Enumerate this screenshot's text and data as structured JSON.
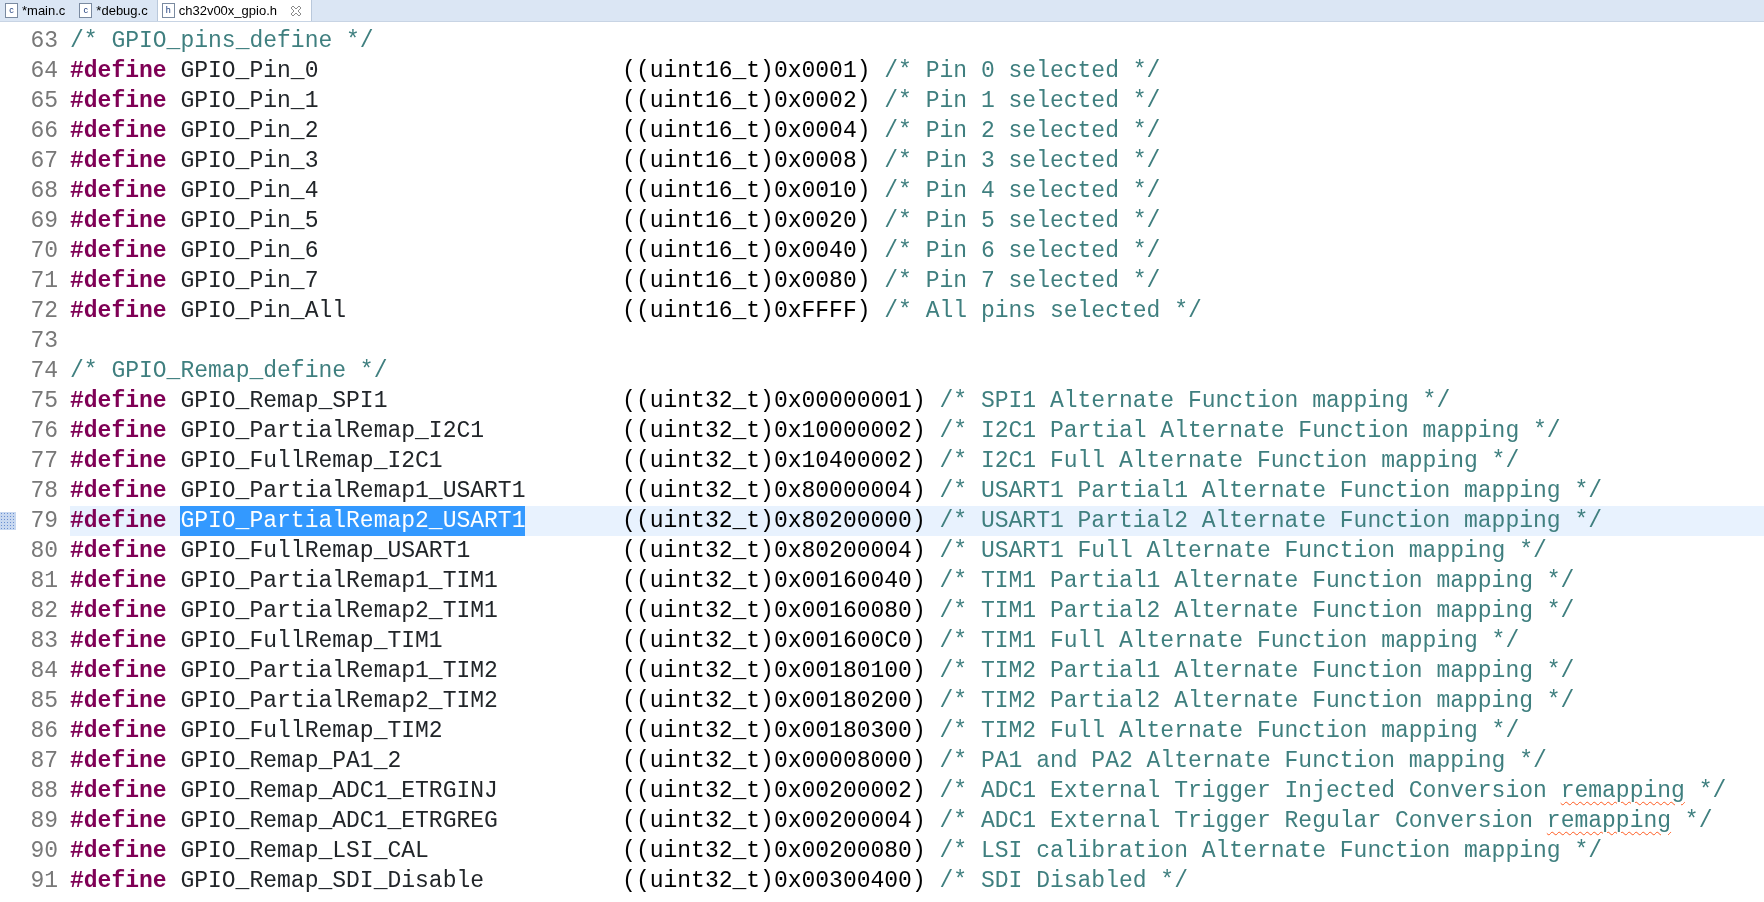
{
  "tabs": [
    {
      "icon": "c",
      "label": "*main.c",
      "selected": false,
      "closable": false
    },
    {
      "icon": "c",
      "label": "*debug.c",
      "selected": false,
      "closable": false
    },
    {
      "icon": "h",
      "label": "ch32v00x_gpio.h",
      "selected": true,
      "closable": true
    }
  ],
  "lines": [
    {
      "number": "63",
      "kind": "comment",
      "comment": "/* GPIO_pins_define */",
      "current": false
    },
    {
      "number": "64",
      "kind": "define",
      "keyword": "#define",
      "name": "GPIO_Pin_0",
      "value": "((uint16_t)0x0001)",
      "comment": "/* Pin 0 selected */",
      "current": false,
      "name_selected": false
    },
    {
      "number": "65",
      "kind": "define",
      "keyword": "#define",
      "name": "GPIO_Pin_1",
      "value": "((uint16_t)0x0002)",
      "comment": "/* Pin 1 selected */",
      "current": false,
      "name_selected": false
    },
    {
      "number": "66",
      "kind": "define",
      "keyword": "#define",
      "name": "GPIO_Pin_2",
      "value": "((uint16_t)0x0004)",
      "comment": "/* Pin 2 selected */",
      "current": false,
      "name_selected": false
    },
    {
      "number": "67",
      "kind": "define",
      "keyword": "#define",
      "name": "GPIO_Pin_3",
      "value": "((uint16_t)0x0008)",
      "comment": "/* Pin 3 selected */",
      "current": false,
      "name_selected": false
    },
    {
      "number": "68",
      "kind": "define",
      "keyword": "#define",
      "name": "GPIO_Pin_4",
      "value": "((uint16_t)0x0010)",
      "comment": "/* Pin 4 selected */",
      "current": false,
      "name_selected": false
    },
    {
      "number": "69",
      "kind": "define",
      "keyword": "#define",
      "name": "GPIO_Pin_5",
      "value": "((uint16_t)0x0020)",
      "comment": "/* Pin 5 selected */",
      "current": false,
      "name_selected": false
    },
    {
      "number": "70",
      "kind": "define",
      "keyword": "#define",
      "name": "GPIO_Pin_6",
      "value": "((uint16_t)0x0040)",
      "comment": "/* Pin 6 selected */",
      "current": false,
      "name_selected": false
    },
    {
      "number": "71",
      "kind": "define",
      "keyword": "#define",
      "name": "GPIO_Pin_7",
      "value": "((uint16_t)0x0080)",
      "comment": "/* Pin 7 selected */",
      "current": false,
      "name_selected": false
    },
    {
      "number": "72",
      "kind": "define",
      "keyword": "#define",
      "name": "GPIO_Pin_All",
      "value": "((uint16_t)0xFFFF)",
      "comment": "/* All pins selected */",
      "current": false,
      "name_selected": false
    },
    {
      "number": "73",
      "kind": "blank",
      "current": false
    },
    {
      "number": "74",
      "kind": "comment",
      "comment": "/* GPIO_Remap_define */",
      "current": false
    },
    {
      "number": "75",
      "kind": "define",
      "keyword": "#define",
      "name": "GPIO_Remap_SPI1",
      "value": "((uint32_t)0x00000001)",
      "comment": "/* SPI1 Alternate Function mapping */",
      "current": false,
      "name_selected": false
    },
    {
      "number": "76",
      "kind": "define",
      "keyword": "#define",
      "name": "GPIO_PartialRemap_I2C1",
      "value": "((uint32_t)0x10000002)",
      "comment": "/* I2C1 Partial Alternate Function mapping */",
      "current": false,
      "name_selected": false
    },
    {
      "number": "77",
      "kind": "define",
      "keyword": "#define",
      "name": "GPIO_FullRemap_I2C1",
      "value": "((uint32_t)0x10400002)",
      "comment": "/* I2C1 Full Alternate Function mapping */",
      "current": false,
      "name_selected": false
    },
    {
      "number": "78",
      "kind": "define",
      "keyword": "#define",
      "name": "GPIO_PartialRemap1_USART1",
      "value": "((uint32_t)0x80000004)",
      "comment": "/* USART1 Partial1 Alternate Function mapping */",
      "current": false,
      "name_selected": false
    },
    {
      "number": "79",
      "kind": "define",
      "keyword": "#define",
      "name": "GPIO_PartialRemap2_USART1",
      "value": "((uint32_t)0x80200000)",
      "comment": "/* USART1 Partial2 Alternate Function mapping */",
      "current": true,
      "name_selected": true
    },
    {
      "number": "80",
      "kind": "define",
      "keyword": "#define",
      "name": "GPIO_FullRemap_USART1",
      "value": "((uint32_t)0x80200004)",
      "comment": "/* USART1 Full Alternate Function mapping */",
      "current": false,
      "name_selected": false
    },
    {
      "number": "81",
      "kind": "define",
      "keyword": "#define",
      "name": "GPIO_PartialRemap1_TIM1",
      "value": "((uint32_t)0x00160040)",
      "comment": "/* TIM1 Partial1 Alternate Function mapping */",
      "current": false,
      "name_selected": false
    },
    {
      "number": "82",
      "kind": "define",
      "keyword": "#define",
      "name": "GPIO_PartialRemap2_TIM1",
      "value": "((uint32_t)0x00160080)",
      "comment": "/* TIM1 Partial2 Alternate Function mapping */",
      "current": false,
      "name_selected": false
    },
    {
      "number": "83",
      "kind": "define",
      "keyword": "#define",
      "name": "GPIO_FullRemap_TIM1",
      "value": "((uint32_t)0x001600C0)",
      "comment": "/* TIM1 Full Alternate Function mapping */",
      "current": false,
      "name_selected": false
    },
    {
      "number": "84",
      "kind": "define",
      "keyword": "#define",
      "name": "GPIO_PartialRemap1_TIM2",
      "value": "((uint32_t)0x00180100)",
      "comment": "/* TIM2 Partial1 Alternate Function mapping */",
      "current": false,
      "name_selected": false
    },
    {
      "number": "85",
      "kind": "define",
      "keyword": "#define",
      "name": "GPIO_PartialRemap2_TIM2",
      "value": "((uint32_t)0x00180200)",
      "comment": "/* TIM2 Partial2 Alternate Function mapping */",
      "current": false,
      "name_selected": false
    },
    {
      "number": "86",
      "kind": "define",
      "keyword": "#define",
      "name": "GPIO_FullRemap_TIM2",
      "value": "((uint32_t)0x00180300)",
      "comment": "/* TIM2 Full Alternate Function mapping */",
      "current": false,
      "name_selected": false
    },
    {
      "number": "87",
      "kind": "define",
      "keyword": "#define",
      "name": "GPIO_Remap_PA1_2",
      "value": "((uint32_t)0x00008000)",
      "comment": "/* PA1 and PA2 Alternate Function mapping */",
      "current": false,
      "name_selected": false
    },
    {
      "number": "88",
      "kind": "define",
      "keyword": "#define",
      "name": "GPIO_Remap_ADC1_ETRGINJ",
      "value": "((uint32_t)0x00200002)",
      "comment_parts": [
        {
          "text": "/* ADC1 External Trigger Injected Conversion ",
          "misspelled": false
        },
        {
          "text": "remapping",
          "misspelled": true
        },
        {
          "text": " */",
          "misspelled": false
        }
      ],
      "current": false,
      "name_selected": false
    },
    {
      "number": "89",
      "kind": "define",
      "keyword": "#define",
      "name": "GPIO_Remap_ADC1_ETRGREG",
      "value": "((uint32_t)0x00200004)",
      "comment_parts": [
        {
          "text": "/* ADC1 External Trigger Regular Conversion ",
          "misspelled": false
        },
        {
          "text": "remapping",
          "misspelled": true
        },
        {
          "text": " */",
          "misspelled": false
        }
      ],
      "current": false,
      "name_selected": false
    },
    {
      "number": "90",
      "kind": "define",
      "keyword": "#define",
      "name": "GPIO_Remap_LSI_CAL",
      "value": "((uint32_t)0x00200080)",
      "comment": "/* LSI calibration Alternate Function mapping */",
      "current": false,
      "name_selected": false
    },
    {
      "number": "91",
      "kind": "define",
      "keyword": "#define",
      "name": "GPIO_Remap_SDI_Disable",
      "value": "((uint32_t)0x00300400)",
      "comment": "/* SDI Disabled */",
      "current": false,
      "name_selected": false
    }
  ]
}
